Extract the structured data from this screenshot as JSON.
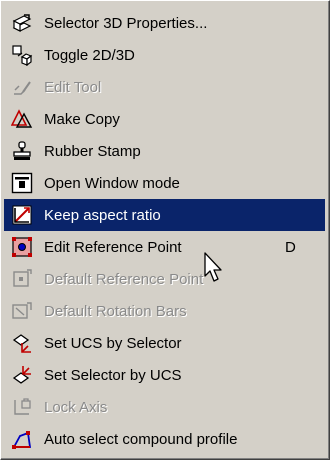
{
  "menu": {
    "items": [
      {
        "label": "Selector 3D Properties...",
        "icon": "properties-3d-icon",
        "disabled": false
      },
      {
        "label": "Toggle 2D/3D",
        "icon": "toggle-2d-3d-icon",
        "disabled": false
      },
      {
        "label": "Edit Tool",
        "icon": "edit-tool-icon",
        "disabled": true
      },
      {
        "label": "Make Copy",
        "icon": "make-copy-icon",
        "disabled": false
      },
      {
        "label": "Rubber Stamp",
        "icon": "rubber-stamp-icon",
        "disabled": false
      },
      {
        "label": "Open Window mode",
        "icon": "open-window-icon",
        "disabled": false
      },
      {
        "label": "Keep aspect ratio",
        "icon": "keep-aspect-ratio-icon",
        "disabled": false,
        "highlighted": true
      },
      {
        "label": "Edit Reference Point",
        "shortcut": "D",
        "icon": "reference-point-icon",
        "disabled": false
      },
      {
        "label": "Default Reference Point",
        "icon": "default-reference-point-icon",
        "disabled": true
      },
      {
        "label": "Default Rotation Bars",
        "icon": "default-rotation-bars-icon",
        "disabled": true
      },
      {
        "label": "Set UCS by Selector",
        "icon": "set-ucs-icon",
        "disabled": false
      },
      {
        "label": "Set Selector by UCS",
        "icon": "set-selector-icon",
        "disabled": false
      },
      {
        "label": "Lock Axis",
        "icon": "lock-axis-icon",
        "disabled": true
      },
      {
        "label": "Auto select compound profile",
        "icon": "compound-profile-icon",
        "disabled": false
      }
    ]
  },
  "colors": {
    "menu_background": "#d4d0c8",
    "highlight": "#0a246a",
    "disabled_text": "#8a8a8a"
  }
}
